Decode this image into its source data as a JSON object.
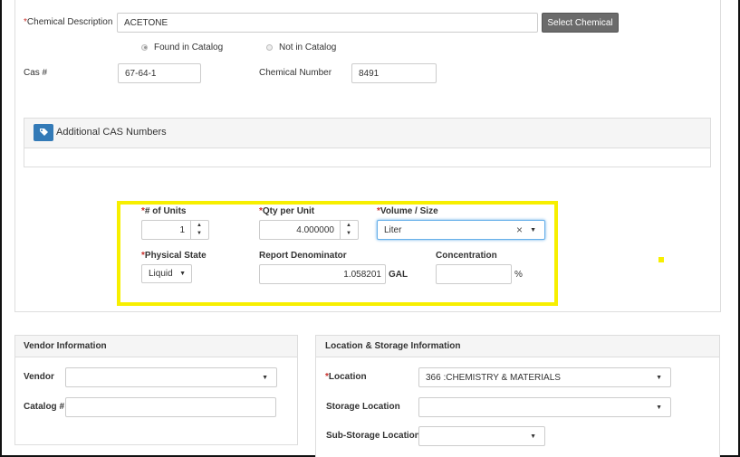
{
  "chemical": {
    "description_label": "Chemical Description",
    "description_value": "ACETONE",
    "select_button": "Select Chemical",
    "radio_found": "Found in Catalog",
    "radio_not_found": "Not in Catalog",
    "cas_label": "Cas #",
    "cas_value": "67-64-1",
    "chem_number_label": "Chemical Number",
    "chem_number_value": "8491"
  },
  "additional_cas": {
    "title": "Additional CAS Numbers",
    "icon": "tag-icon"
  },
  "quantity": {
    "units_label": "# of Units",
    "units_value": "1",
    "qty_label": "Qty per Unit",
    "qty_value": "4.000000",
    "volume_label": "Volume / Size",
    "volume_value": "Liter",
    "clear_symbol": "×",
    "physical_state_label": "Physical State",
    "physical_state_value": "Liquid",
    "report_denominator_label": "Report Denominator",
    "report_denominator_value": "1.058201",
    "report_denominator_unit": "GAL",
    "concentration_label": "Concentration",
    "concentration_value": "",
    "concentration_unit": "%"
  },
  "vendor": {
    "title": "Vendor Information",
    "vendor_label": "Vendor",
    "vendor_value": "",
    "catalog_label": "Catalog #",
    "catalog_value": ""
  },
  "location": {
    "title": "Location & Storage Information",
    "location_label": "Location",
    "location_value": "366 :CHEMISTRY & MATERIALS",
    "storage_label": "Storage Location",
    "storage_value": "",
    "substorage_label": "Sub-Storage Location",
    "substorage_value": ""
  },
  "colors": {
    "required": "#c9302c",
    "highlight": "#f7ef00",
    "tag_button": "#337ab7",
    "select_button": "#6b6b6b"
  },
  "symbols": {
    "required_mark": "*",
    "caret": "▼",
    "up": "▲",
    "down": "▼"
  }
}
